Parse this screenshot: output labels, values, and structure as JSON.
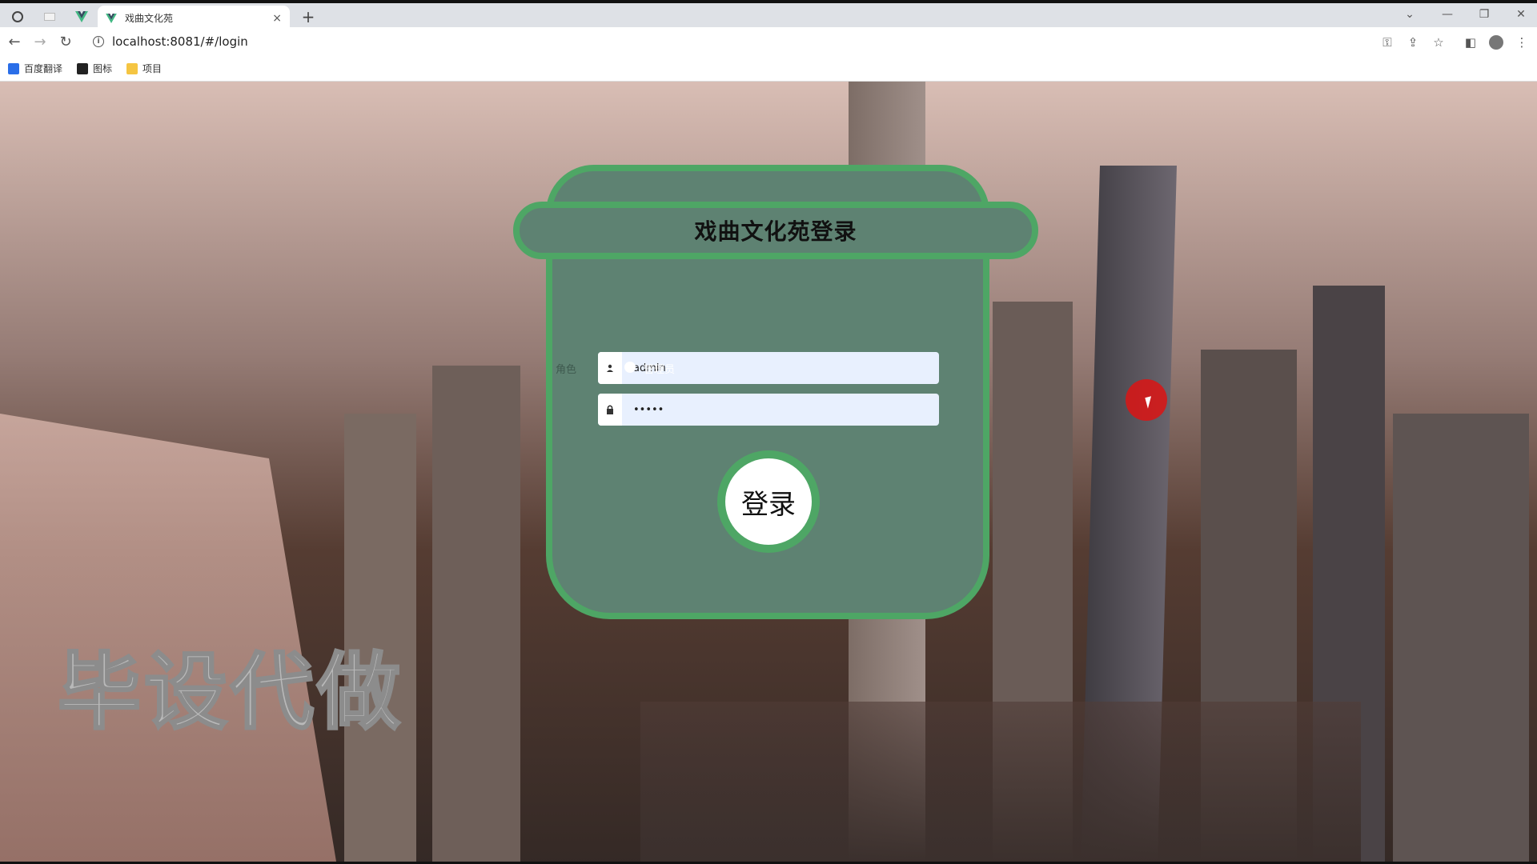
{
  "browser": {
    "tab_title": "戏曲文化苑",
    "tab_close": "×",
    "new_tab": "+",
    "url": "localhost:8081/#/login",
    "bookmarks": [
      {
        "label": "百度翻译",
        "color": "#2a6ee8"
      },
      {
        "label": "图标",
        "color": "#222222"
      },
      {
        "label": "项目",
        "color": "#f5c542"
      }
    ]
  },
  "login": {
    "title": "戏曲文化苑登录",
    "username_value": "admin",
    "password_value": "•••••",
    "role_label": "角色",
    "role_option": "管理员",
    "submit_label": "登录"
  },
  "watermark": "毕设代做",
  "colors": {
    "card_fill": "#5e8272",
    "card_border": "#4ea665"
  }
}
